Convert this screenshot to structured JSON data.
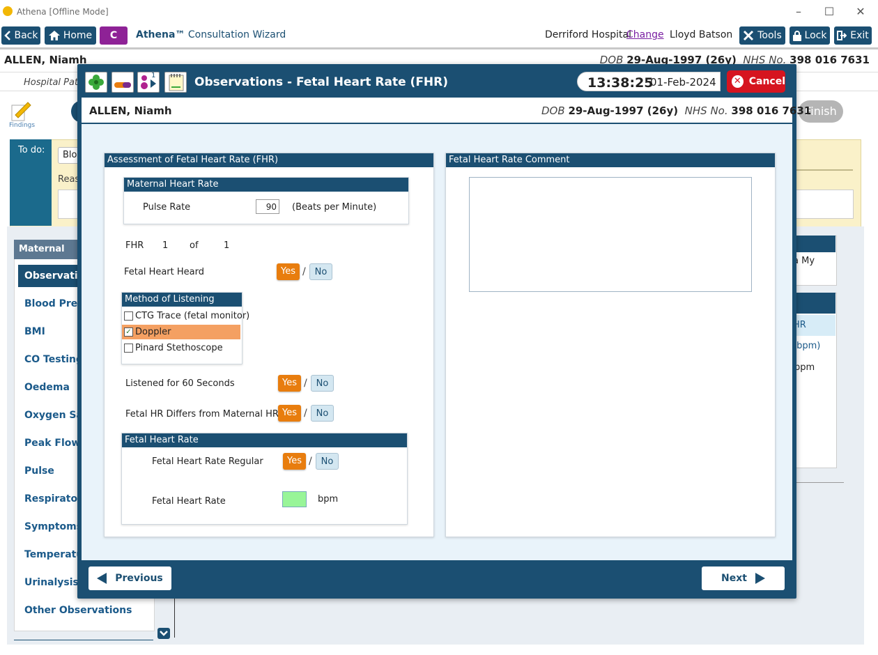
{
  "window": {
    "title": "Athena [Offline Mode]"
  },
  "toolbar": {
    "back_label": "Back",
    "home_label": "Home",
    "c_label": "C",
    "wizard_brand": "Athena™",
    "wizard_title": "Consultation Wizard",
    "hospital": "Derriford Hospital",
    "change_label": "Change",
    "user": "Lloyd Batson",
    "tools_label": "Tools",
    "lock_label": "Lock",
    "exit_label": "Exit"
  },
  "patient": {
    "name": "ALLEN, Niamh",
    "dob_label": "DOB",
    "dob_value": "29-Aug-1997 (26y)",
    "nhs_label": "NHS No.",
    "nhs_value": "398 016 7631",
    "hospital_patient_label": "Hospital Patie"
  },
  "background": {
    "findings_label": "Findings",
    "finish_label": "Finish",
    "todo_label": "To do:",
    "todo_chip": "Bloo",
    "todo_reason": "Reas",
    "nav_header": "Maternal",
    "nav_active": "Observation",
    "nav_items": [
      "Blood Press",
      "BMI",
      "CO Testing",
      "Oedema",
      "Oxygen Sat",
      "Peak Flow",
      "Pulse",
      "Respiratory",
      "Symptoms",
      "Temperatur",
      "Urinalysis",
      "Other Observations"
    ],
    "right_card1_text": "a My",
    "right_card2_sub": "HR (bpm)",
    "right_card2_val": "bpm"
  },
  "modal": {
    "title": "Observations - Fetal Heart Rate (FHR)",
    "time": "13:38:25",
    "date": "01-Feb-2024",
    "cancel_label": "Cancel",
    "icon_counter": "1",
    "assessment_header": "Assessment of Fetal Heart Rate (FHR)",
    "comment_header": "Fetal Heart Rate Comment",
    "comment_value": "",
    "maternal_header": "Maternal Heart Rate",
    "pulse_label": "Pulse Rate",
    "pulse_value": "90",
    "pulse_unit": "(Beats per Minute)",
    "fhr_label": "FHR",
    "fhr_index": "1",
    "fhr_of": "of",
    "fhr_total": "1",
    "heard_label": "Fetal Heart Heard",
    "yes_label": "Yes",
    "no_label": "No",
    "slash": "/",
    "method_header": "Method of Listening",
    "methods": [
      {
        "label": "CTG Trace (fetal monitor)",
        "checked": false
      },
      {
        "label": "Doppler",
        "checked": true
      },
      {
        "label": "Pinard Stethoscope",
        "checked": false
      }
    ],
    "listened_label": "Listened for 60 Seconds",
    "differs_label": "Fetal HR Differs from Maternal HR",
    "fhr_panel_header": "Fetal Heart Rate",
    "regular_label": "Fetal Heart Rate Regular",
    "rate_label": "Fetal Heart Rate",
    "rate_value": "",
    "rate_unit": "bpm",
    "previous_label": "Previous",
    "next_label": "Next"
  },
  "colors": {
    "primary": "#1b4f72",
    "accent_yes": "#e87d0e",
    "cancel": "#d6141f",
    "selected_row": "#f4a062",
    "rate_input": "#98f598"
  }
}
